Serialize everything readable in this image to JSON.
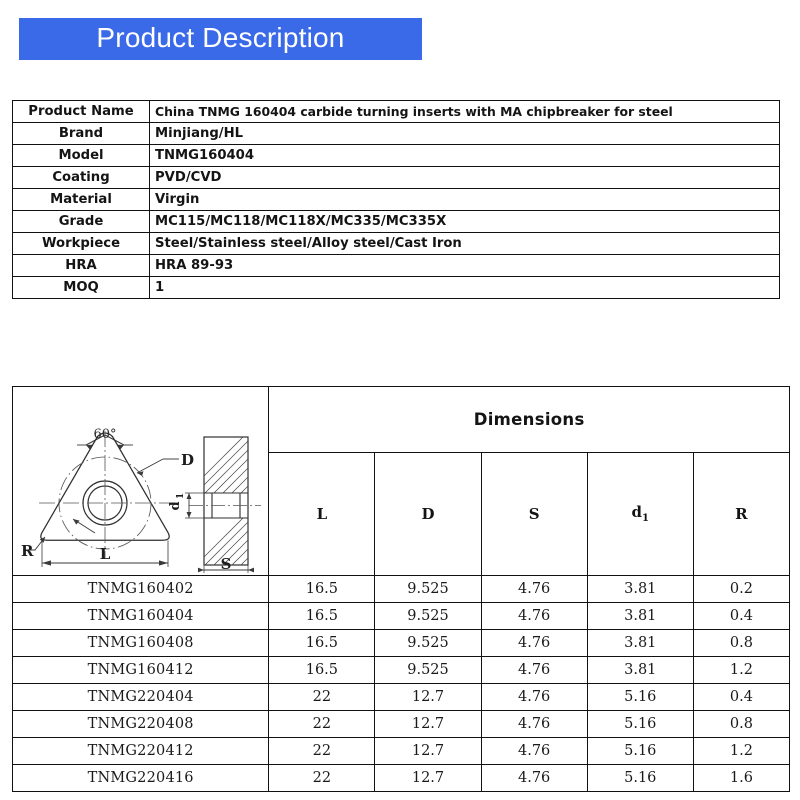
{
  "banner": {
    "title": "Product Description",
    "bg_color": "#3b6ae8",
    "text_color": "#ffffff"
  },
  "spec_table": {
    "rows": [
      {
        "label": "Product Name",
        "value": "China TNMG 160404 carbide turning inserts  with MA chipbreaker for steel"
      },
      {
        "label": "Brand",
        "value": "Minjiang/HL"
      },
      {
        "label": "Model",
        "value": "TNMG160404"
      },
      {
        "label": "Coating",
        "value": "PVD/CVD"
      },
      {
        "label": "Material",
        "value": "Virgin"
      },
      {
        "label": "Grade",
        "value": "MC115/MC118/MC118X/MC335/MC335X"
      },
      {
        "label": "Workpiece",
        "value": "Steel/Stainless steel/Alloy steel/Cast Iron"
      },
      {
        "label": "HRA",
        "value": "HRA 89-93"
      },
      {
        "label": "MOQ",
        "value": "1"
      }
    ]
  },
  "dimensions_table": {
    "group_header": "Dimensions",
    "figure": {
      "labels": {
        "angle": "60°",
        "diameter": "D",
        "length": "L",
        "radius": "R",
        "hole": "d",
        "hole_sub": "1",
        "thickness": "S"
      }
    },
    "columns": [
      "L",
      "D",
      "S",
      "d",
      "R"
    ],
    "column_sub": [
      null,
      null,
      null,
      "1",
      null
    ],
    "rows": [
      {
        "name": "TNMG160402",
        "L": "16.5",
        "D": "9.525",
        "S": "4.76",
        "d1": "3.81",
        "R": "0.2"
      },
      {
        "name": "TNMG160404",
        "L": "16.5",
        "D": "9.525",
        "S": "4.76",
        "d1": "3.81",
        "R": "0.4"
      },
      {
        "name": "TNMG160408",
        "L": "16.5",
        "D": "9.525",
        "S": "4.76",
        "d1": "3.81",
        "R": "0.8"
      },
      {
        "name": "TNMG160412",
        "L": "16.5",
        "D": "9.525",
        "S": "4.76",
        "d1": "3.81",
        "R": "1.2"
      },
      {
        "name": "TNMG220404",
        "L": "22",
        "D": "12.7",
        "S": "4.76",
        "d1": "5.16",
        "R": "0.4"
      },
      {
        "name": "TNMG220408",
        "L": "22",
        "D": "12.7",
        "S": "4.76",
        "d1": "5.16",
        "R": "0.8"
      },
      {
        "name": "TNMG220412",
        "L": "22",
        "D": "12.7",
        "S": "4.76",
        "d1": "5.16",
        "R": "1.2"
      },
      {
        "name": "TNMG220416",
        "L": "22",
        "D": "12.7",
        "S": "4.76",
        "d1": "5.16",
        "R": "1.6"
      }
    ]
  }
}
